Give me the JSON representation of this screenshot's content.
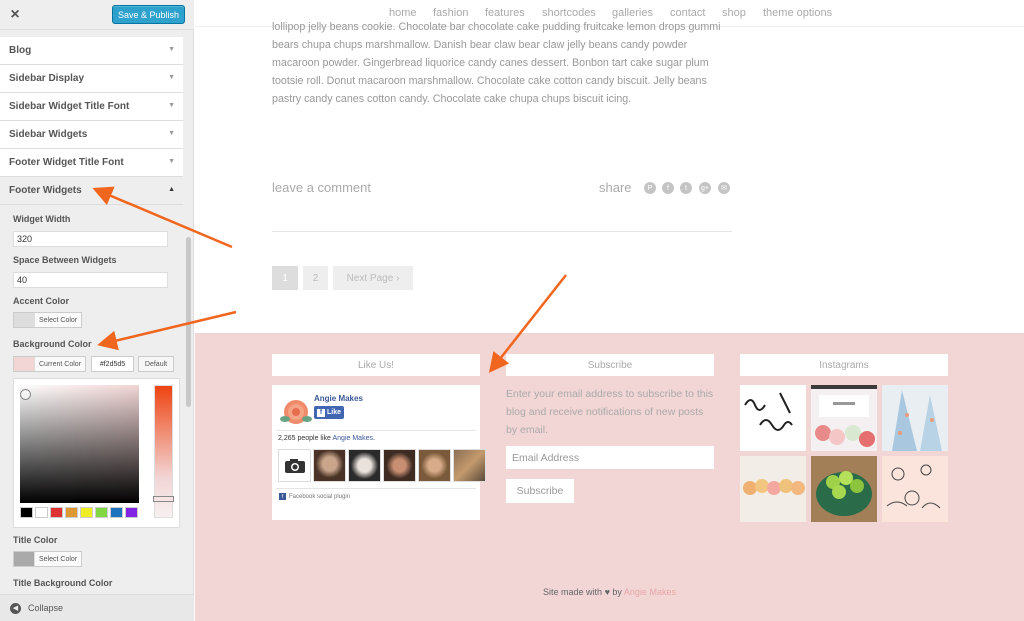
{
  "sidebar": {
    "close_label": "×",
    "save_label": "Save & Publish",
    "sections": [
      {
        "label": "Blog"
      },
      {
        "label": "Sidebar Display"
      },
      {
        "label": "Sidebar Widget Title Font"
      },
      {
        "label": "Sidebar Widgets"
      },
      {
        "label": "Footer Widget Title Font"
      },
      {
        "label": "Footer Widgets"
      }
    ],
    "arrow_closed": "▼",
    "arrow_open": "▲",
    "panel": {
      "widget_width_label": "Widget Width",
      "widget_width_value": "320",
      "space_label": "Space Between Widgets",
      "space_value": "40",
      "accent_label": "Accent Color",
      "accent_button": "Select Color",
      "bg_label": "Background Color",
      "bg_current_button": "Current Color",
      "bg_hex": "#f2d5d5",
      "bg_default_button": "Default",
      "title_color_label": "Title Color",
      "title_color_button": "Select Color",
      "title_bg_label": "Title Background Color"
    },
    "palette": [
      "#000000",
      "#ffffff",
      "#dd3333",
      "#dd9933",
      "#eeee22",
      "#81d742",
      "#1e73be",
      "#8224e3"
    ],
    "collapse_label": "Collapse"
  },
  "site": {
    "nav": [
      "home",
      "fashion",
      "features",
      "shortcodes",
      "galleries",
      "contact",
      "shop",
      "theme options"
    ],
    "body_text": "lollipop jelly beans cookie. Chocolate bar chocolate cake pudding fruitcake lemon drops gummi bears chupa chups marshmallow. Danish bear claw bear claw jelly beans candy powder macaroon powder. Gingerbread liquorice candy canes dessert. Bonbon tart cake sugar plum tootsie roll. Donut macaroon marshmallow. Chocolate cake cotton candy biscuit. Jelly beans pastry candy canes cotton candy. Chocolate cake chupa chups biscuit icing.",
    "leave_comment": "leave a comment",
    "share_label": "share",
    "share_icons": [
      "pinterest-icon",
      "facebook-icon",
      "twitter-icon",
      "google-plus-icon",
      "email-icon"
    ],
    "share_glyphs": [
      "P",
      "f",
      "t",
      "g+",
      "✉"
    ],
    "pagination": {
      "current": "1",
      "next_page": "2",
      "next_label": "Next Page ›"
    },
    "footer": {
      "like_title": "Like Us!",
      "fb_page_name": "Angie Makes",
      "fb_like": "Like",
      "fb_count_prefix": "2,265 people like ",
      "fb_count_page": "Angie Makes",
      "fb_count_suffix": ".",
      "fb_plugin": "Facebook social plugin",
      "subscribe_title": "Subscribe",
      "subscribe_text": "Enter your email address to subscribe to this blog and receive notifications of new posts by email.",
      "email_placeholder": "Email Address",
      "subscribe_button": "Subscribe",
      "instagram_title": "Instagrams",
      "credit_prefix": "Site made with ",
      "credit_heart": "♥",
      "credit_by": " by ",
      "credit_author": "Angie Makes"
    }
  },
  "colors": {
    "accent": "#2ea2cc",
    "footer_bg": "#f2d5d5",
    "arrow": "#f0661e"
  }
}
